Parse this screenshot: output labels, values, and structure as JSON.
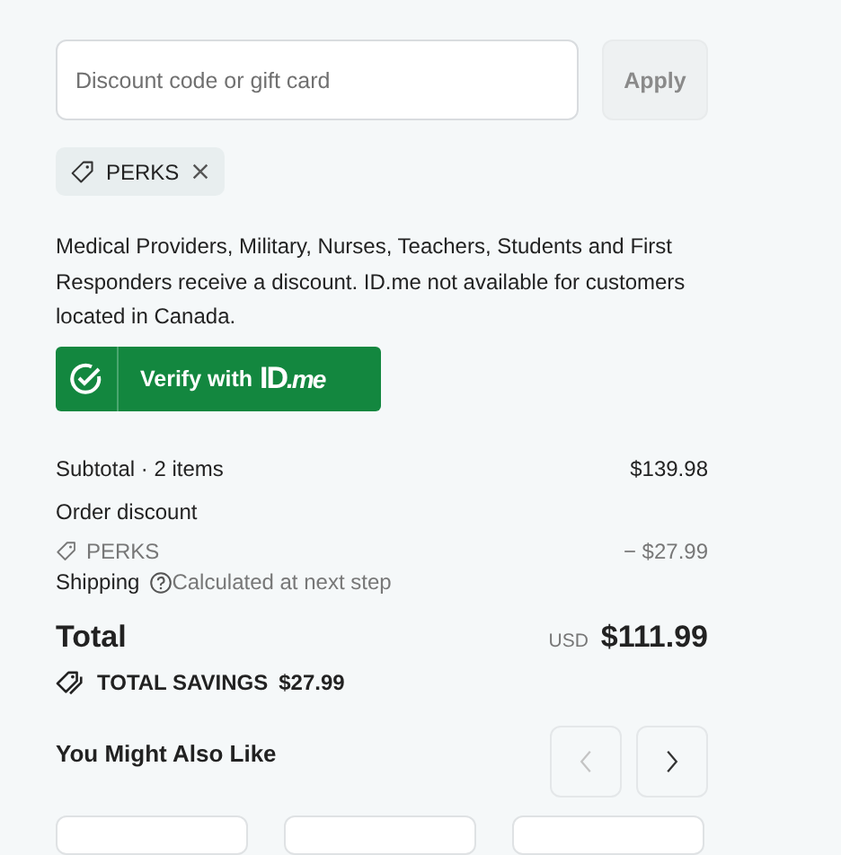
{
  "discount": {
    "placeholder": "Discount code or gift card",
    "apply_button": "Apply",
    "apply_disabled": true
  },
  "applied_codes": [
    {
      "code": "PERKS"
    }
  ],
  "notice": "Medical Providers, Military, Nurses, Teachers, Students and First Responders receive a discount. ID.me not available for customers located in Canada.",
  "verify_button": {
    "label": "Verify with",
    "brand": "ID.me"
  },
  "summary": [
    {
      "kind": "line",
      "label": "Subtotal · 2 items",
      "value": "$139.98"
    },
    {
      "kind": "heading",
      "label": "Order discount"
    },
    {
      "kind": "code",
      "label": "PERKS",
      "value": "− $27.99"
    },
    {
      "kind": "help",
      "label": "Shipping",
      "value": "Calculated at next step"
    }
  ],
  "total": {
    "label": "Total",
    "currency": "USD",
    "amount": "$111.99"
  },
  "savings": {
    "label": "TOTAL SAVINGS",
    "amount": "$27.99"
  },
  "recommendations": {
    "title": "You Might Also Like",
    "prev_disabled": true,
    "next_disabled": false
  }
}
